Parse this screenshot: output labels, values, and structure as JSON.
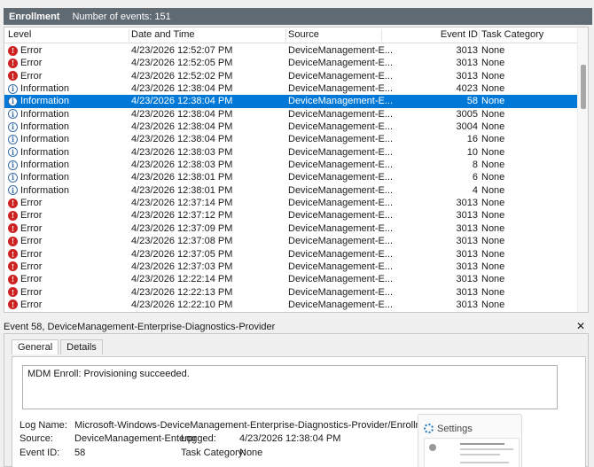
{
  "header": {
    "title": "Enrollment",
    "count_text": "Number of events: 151"
  },
  "columns": {
    "level": "Level",
    "datetime": "Date and Time",
    "source": "Source",
    "event_id": "Event ID",
    "task_category": "Task Category"
  },
  "rows": [
    {
      "level": "Error",
      "datetime": "4/23/2026 12:52:07 PM",
      "source": "DeviceManagement-E...",
      "event_id": "3013",
      "category": "None"
    },
    {
      "level": "Error",
      "datetime": "4/23/2026 12:52:05 PM",
      "source": "DeviceManagement-E...",
      "event_id": "3013",
      "category": "None"
    },
    {
      "level": "Error",
      "datetime": "4/23/2026 12:52:02 PM",
      "source": "DeviceManagement-E...",
      "event_id": "3013",
      "category": "None"
    },
    {
      "level": "Information",
      "datetime": "4/23/2026 12:38:04 PM",
      "source": "DeviceManagement-E...",
      "event_id": "4023",
      "category": "None"
    },
    {
      "level": "Information",
      "datetime": "4/23/2026 12:38:04 PM",
      "source": "DeviceManagement-E...",
      "event_id": "58",
      "category": "None",
      "selected": true
    },
    {
      "level": "Information",
      "datetime": "4/23/2026 12:38:04 PM",
      "source": "DeviceManagement-E...",
      "event_id": "3005",
      "category": "None"
    },
    {
      "level": "Information",
      "datetime": "4/23/2026 12:38:04 PM",
      "source": "DeviceManagement-E...",
      "event_id": "3004",
      "category": "None"
    },
    {
      "level": "Information",
      "datetime": "4/23/2026 12:38:04 PM",
      "source": "DeviceManagement-E...",
      "event_id": "16",
      "category": "None"
    },
    {
      "level": "Information",
      "datetime": "4/23/2026 12:38:03 PM",
      "source": "DeviceManagement-E...",
      "event_id": "10",
      "category": "None"
    },
    {
      "level": "Information",
      "datetime": "4/23/2026 12:38:03 PM",
      "source": "DeviceManagement-E...",
      "event_id": "8",
      "category": "None"
    },
    {
      "level": "Information",
      "datetime": "4/23/2026 12:38:01 PM",
      "source": "DeviceManagement-E...",
      "event_id": "6",
      "category": "None"
    },
    {
      "level": "Information",
      "datetime": "4/23/2026 12:38:01 PM",
      "source": "DeviceManagement-E...",
      "event_id": "4",
      "category": "None"
    },
    {
      "level": "Error",
      "datetime": "4/23/2026 12:37:14 PM",
      "source": "DeviceManagement-E...",
      "event_id": "3013",
      "category": "None"
    },
    {
      "level": "Error",
      "datetime": "4/23/2026 12:37:12 PM",
      "source": "DeviceManagement-E...",
      "event_id": "3013",
      "category": "None"
    },
    {
      "level": "Error",
      "datetime": "4/23/2026 12:37:09 PM",
      "source": "DeviceManagement-E...",
      "event_id": "3013",
      "category": "None"
    },
    {
      "level": "Error",
      "datetime": "4/23/2026 12:37:08 PM",
      "source": "DeviceManagement-E...",
      "event_id": "3013",
      "category": "None"
    },
    {
      "level": "Error",
      "datetime": "4/23/2026 12:37:05 PM",
      "source": "DeviceManagement-E...",
      "event_id": "3013",
      "category": "None"
    },
    {
      "level": "Error",
      "datetime": "4/23/2026 12:37:03 PM",
      "source": "DeviceManagement-E...",
      "event_id": "3013",
      "category": "None"
    },
    {
      "level": "Error",
      "datetime": "4/23/2026 12:22:14 PM",
      "source": "DeviceManagement-E...",
      "event_id": "3013",
      "category": "None"
    },
    {
      "level": "Error",
      "datetime": "4/23/2026 12:22:13 PM",
      "source": "DeviceManagement-E...",
      "event_id": "3013",
      "category": "None"
    },
    {
      "level": "Error",
      "datetime": "4/23/2026 12:22:10 PM",
      "source": "DeviceManagement-E...",
      "event_id": "3013",
      "category": "None"
    }
  ],
  "detail": {
    "title": "Event 58, DeviceManagement-Enterprise-Diagnostics-Provider",
    "close_glyph": "✕",
    "tabs": [
      "General",
      "Details"
    ],
    "message": "MDM Enroll: Provisioning succeeded.",
    "log_name_label": "Log Name:",
    "log_name": "Microsoft-Windows-DeviceManagement-Enterprise-Diagnostics-Provider/Enrollment",
    "source_label": "Source:",
    "source": "DeviceManagement-Enterpr",
    "logged_label": "Logged:",
    "logged": "4/23/2026 12:38:04 PM",
    "event_id_label": "Event ID:",
    "event_id": "58",
    "task_category_label": "Task Category:",
    "task_category": "None",
    "settings_label": "Settings"
  },
  "colors": {
    "selection": "#0078d7",
    "error": "#cc2222",
    "info": "#3a6ea8",
    "titlebar": "#5f6a73"
  },
  "icons": {
    "error": "error-icon",
    "information": "information-icon"
  }
}
